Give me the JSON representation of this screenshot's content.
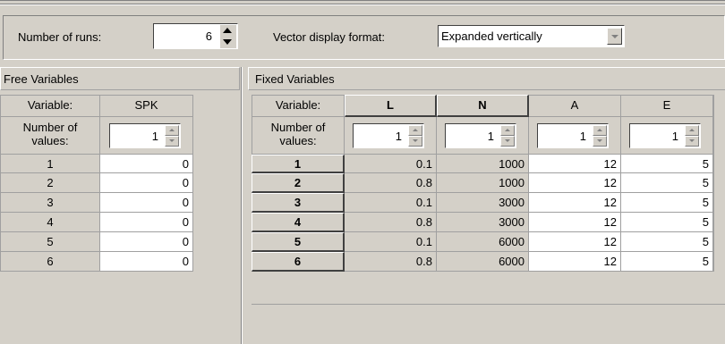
{
  "top": {
    "runs_label": "Number of runs:",
    "runs_value": "6",
    "format_label": "Vector display format:",
    "format_value": "Expanded vertically"
  },
  "free": {
    "title": "Free Variables",
    "variable_label": "Variable:",
    "count_label": "Number of values:",
    "var_name": "SPK",
    "count": "1",
    "rows": [
      {
        "idx": "1",
        "val": "0"
      },
      {
        "idx": "2",
        "val": "0"
      },
      {
        "idx": "3",
        "val": "0"
      },
      {
        "idx": "4",
        "val": "0"
      },
      {
        "idx": "5",
        "val": "0"
      },
      {
        "idx": "6",
        "val": "0"
      }
    ]
  },
  "fixed": {
    "title": "Fixed Variables",
    "variable_label": "Variable:",
    "count_label": "Number of values:",
    "columns": [
      {
        "name": "L",
        "count": "1"
      },
      {
        "name": "N",
        "count": "1"
      },
      {
        "name": "A",
        "count": "1"
      },
      {
        "name": "E",
        "count": "1"
      }
    ],
    "rows": [
      {
        "idx": "1",
        "L": "0.1",
        "N": "1000",
        "A": "12",
        "E": "5"
      },
      {
        "idx": "2",
        "L": "0.8",
        "N": "1000",
        "A": "12",
        "E": "5"
      },
      {
        "idx": "3",
        "L": "0.1",
        "N": "3000",
        "A": "12",
        "E": "5"
      },
      {
        "idx": "4",
        "L": "0.8",
        "N": "3000",
        "A": "12",
        "E": "5"
      },
      {
        "idx": "5",
        "L": "0.1",
        "N": "6000",
        "A": "12",
        "E": "5"
      },
      {
        "idx": "6",
        "L": "0.8",
        "N": "6000",
        "A": "12",
        "E": "5"
      }
    ]
  }
}
